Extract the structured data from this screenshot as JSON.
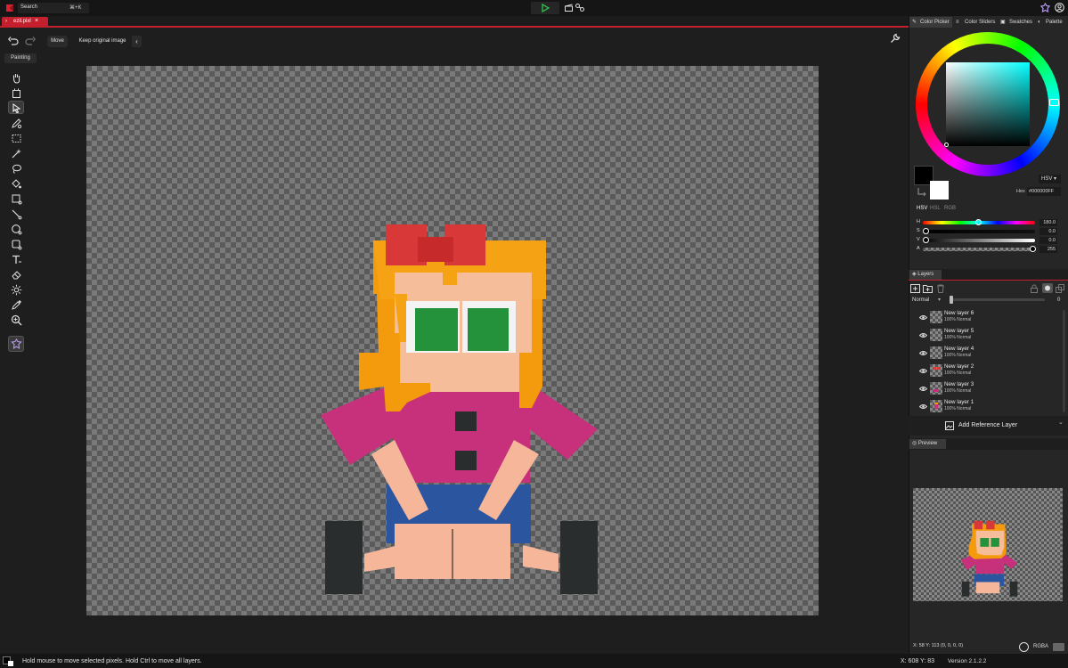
{
  "topbar": {
    "search_label": "Search",
    "search_shortcut": "⌘+K"
  },
  "tabs": {
    "file_tab_label": "ezil.pixl",
    "file_tab_close": "×"
  },
  "toolbar": {
    "move_label": "Move",
    "keep_original_label": "Keep original image"
  },
  "left_tools": {
    "painting_badge": "Painting",
    "tools": [
      "hand-icon",
      "crop-icon",
      "move-select-icon",
      "pencil-icon",
      "rect-select-icon",
      "magic-wand-icon",
      "bucket-fill-icon",
      "fill-selection-icon",
      "line-icon",
      "circle-icon",
      "rectangle-icon",
      "text-icon",
      "eraser-icon",
      "lighten-icon",
      "eyedropper-icon",
      "zoom-icon"
    ],
    "active_tool": "move-select-icon"
  },
  "right_panel": {
    "tabs": [
      "Color Picker",
      "Color Sliders",
      "Swatches",
      "Palette"
    ],
    "active_tab": "Color Picker",
    "color_mode_select": "HSV",
    "hex_label": "Hex",
    "hex_value": "#000000FF",
    "mode_tabs": [
      "HSV",
      "HSL",
      "RGB"
    ],
    "sliders": [
      {
        "label": "H",
        "value": "180.0"
      },
      {
        "label": "S",
        "value": "0.0"
      },
      {
        "label": "V",
        "value": "0.0"
      },
      {
        "label": "A",
        "value": "255"
      }
    ],
    "colors": {
      "primary": "#000000",
      "secondary": "#ffffff",
      "accent": "#c31f2d",
      "wheel_hue": "#00ffff"
    }
  },
  "layers_panel": {
    "title": "Layers",
    "blend_mode": "Normal",
    "opacity_value": "0",
    "layers": [
      {
        "name": "New layer 6",
        "info": "100%  Normal"
      },
      {
        "name": "New layer 5",
        "info": "100%  Normal"
      },
      {
        "name": "New layer 4",
        "info": "100%  Normal"
      },
      {
        "name": "New layer 2",
        "info": "100%  Normal"
      },
      {
        "name": "New layer 3",
        "info": "100%  Normal"
      },
      {
        "name": "New layer 1",
        "info": "100%  Normal"
      }
    ],
    "add_reference_label": "Add Reference Layer"
  },
  "preview_panel": {
    "title": "Preview",
    "cursor_info": "X: 58 Y: 113   (0, 0, 0, 0)",
    "color_format": "RGBA"
  },
  "status": {
    "message": "Hold mouse to move selected pixels. Hold Ctrl to move all layers.",
    "coords": "X: 608 Y: 83",
    "version": "Version 2.1.2.2"
  }
}
